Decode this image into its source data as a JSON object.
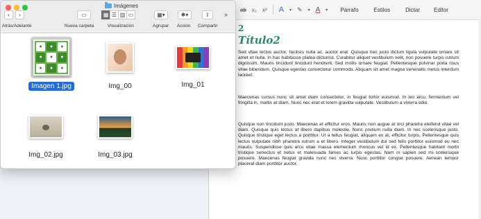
{
  "finder": {
    "title": "Imágenes",
    "toolbar": {
      "nav_label": "Atrás/Adelante",
      "new_folder_label": "Nueva carpeta",
      "view_label": "Visualización",
      "group_label": "Agrupar",
      "action_label": "Acción",
      "share_label": "Compartir",
      "more": "»"
    },
    "files": [
      {
        "name": "Imagen 1.jpg",
        "selected": true
      },
      {
        "name": "Img_00"
      },
      {
        "name": "Img_01"
      },
      {
        "name": "Img_02.jpg"
      },
      {
        "name": "Img_03.jpg"
      }
    ]
  },
  "doc": {
    "toolbar": {
      "strike": "ab",
      "sub": "x₂",
      "sup": "x²",
      "style_btn": "Párrafo",
      "styles_btn": "Estilos",
      "dictate_btn": "Dictar",
      "editor_btn": "Editor"
    },
    "heading2": "2",
    "heading1": "Título2",
    "paragraphs": [
      "Sed vitae lectus auctor, facilisis nulla ac, auctor erat. Quisque nec justo dictum ligula vulputate ornare sit amet et nulla. In hac habitasse platea dictumst. Curabitur aliquet vestibulum velit, non posuere turpis rutrum dignissim. Mauris tincidunt tincidunt hendrerit. Sed mollis ornare feugiat. Pellentesque pulvinar porta risus vitae bibendum. Quisque egestas consectetur commodo. Aliquam sit amet magna venenatis metus interdum laoreet.",
      "Maecenas cursus nunc sit amet diam consectetur, in feugiat tortor euismod. In leo arcu, fermentum vel fringilla in, mattis at diam. Nunc nec erat et lorem gravida vulputate. Vestibulum a viverra odio.",
      "Quisque non tincidunt justo. Maecenas et efficitur eros. Mauris non augue at orci pharetra eleifend vitae vel diam. Quisque quis lectus at libero dapibus molestie. Nunc pretium nulla diam. In nec scelerisque justo. Quisque tristique eget lectus a porttitor. Ut a tellus feugiat, aliquam ex at, efficitur turpis. Pellentesque quis lectus vulputate nibh pharetra rutrum a et libero. Integer vestibulum dui sed felis porttitor euismod eu nec mauris. Suspendisse quis arcu vitae massa elementum rhoncus vel id ex. Pellentesque habitant morbi tristique senectus et netus et malesuada fames ac turpis egestas. Nam in sapien sed mi scelerisque posuere. Maecenas feugiat gravida nunc nec viverra. Nunc porttitor congue posuere. Aenean tempor placerat diam porttitor auctor."
    ],
    "colors": {
      "heading": "#2d8a6d"
    }
  },
  "icons": {
    "back": "chevron-left-icon",
    "forward": "chevron-right-icon",
    "new_folder": "folder-plus-icon",
    "views": [
      "icon-view-icon",
      "list-view-icon",
      "column-view-icon",
      "gallery-view-icon"
    ],
    "group": "group-icon",
    "action": "gear-icon",
    "share": "share-icon"
  }
}
